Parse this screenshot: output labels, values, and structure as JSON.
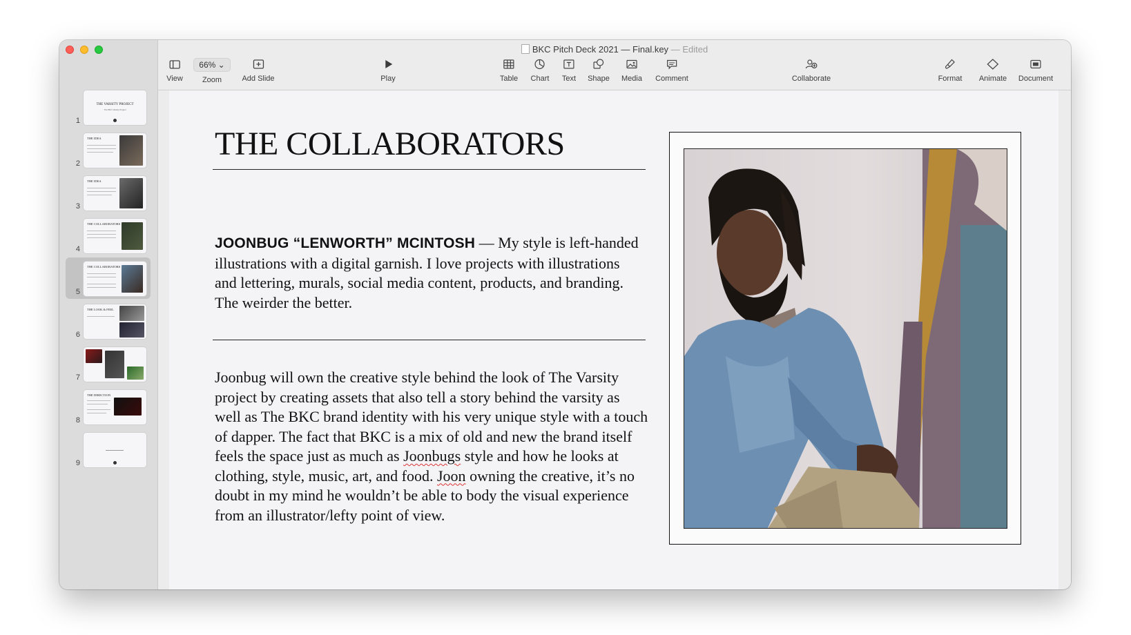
{
  "window": {
    "title": "BKC Pitch Deck 2021 — Final.key",
    "title_separator": "—",
    "title_status": "Edited"
  },
  "toolbar": {
    "view": "View",
    "zoom_value": "66%",
    "zoom": "Zoom",
    "add_slide": "Add Slide",
    "play": "Play",
    "table": "Table",
    "chart": "Chart",
    "text": "Text",
    "shape": "Shape",
    "media": "Media",
    "comment": "Comment",
    "collaborate": "Collaborate",
    "format": "Format",
    "animate": "Animate",
    "document": "Document"
  },
  "slides": [
    {
      "number": "1",
      "title": "THE VARSITY PROJECT",
      "subtitle": "The BKC Varsity Project"
    },
    {
      "number": "2",
      "title": "THE IDEA"
    },
    {
      "number": "3",
      "title": "THE IDEA"
    },
    {
      "number": "4",
      "title": "THE COLLABORATORS"
    },
    {
      "number": "5",
      "title": "THE COLLABORATORS"
    },
    {
      "number": "6",
      "title": "THE LOOK & FEEL"
    },
    {
      "number": "7"
    },
    {
      "number": "8",
      "title": "THE DIRECTION"
    },
    {
      "number": "9"
    }
  ],
  "selected_slide": 5,
  "slide": {
    "title": "THE COLLABORATORS",
    "bio_name": "JOONBUG “LENWORTH” MCINTOSH",
    "bio_text": " — My style is left-handed illustrations with a digital garnish. I love projects with illustrations and lettering, murals, social media content, products, and branding. The weirder the better.",
    "body_part1": "Joonbug will own the creative style behind the look of The Varsity project by creating assets that also tell a story behind the varsity as well as The BKC brand identity with his very unique style with a touch of dapper. The fact that BKC is a mix of old and new the brand itself feels the space just as much as ",
    "body_word1": "Joonbugs",
    "body_part2": " style and how he looks at clothing, style, music, art, and food. ",
    "body_word2": "Joon",
    "body_part3": " owning the creative, it’s no doubt in my mind he wouldn’t be able to body the visual experience from an illustrator/lefty point of view."
  },
  "colors": {
    "close": "#ff5f57",
    "minimize": "#febc2e",
    "maximize": "#28c840",
    "slide_bg": "#f4f3f6",
    "selection": "#c3c3c3"
  }
}
